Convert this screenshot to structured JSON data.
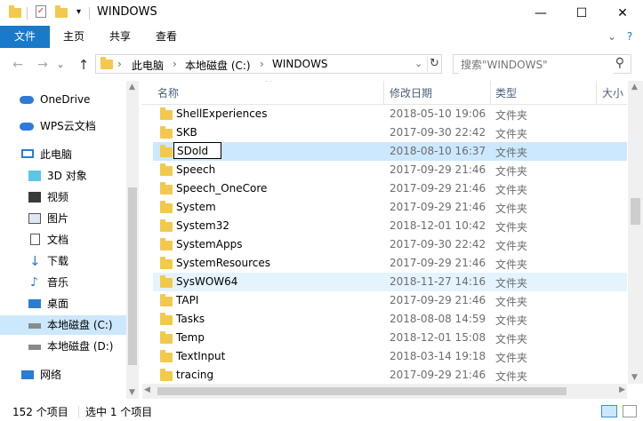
{
  "window": {
    "title": "WINDOWS",
    "minimize": "—",
    "maximize": "☐",
    "close": "✕"
  },
  "ribbon": {
    "tabs": [
      "文件",
      "主页",
      "共享",
      "查看"
    ],
    "expand": "⌄",
    "help": "?"
  },
  "address": {
    "back": "←",
    "forward": "→",
    "recent": "⌄",
    "up": "↑",
    "crumbs": [
      "此电脑",
      "本地磁盘 (C:)",
      "WINDOWS"
    ],
    "separator": "›",
    "dropdown": "⌄",
    "refresh": "↻"
  },
  "search": {
    "placeholder": "搜索\"WINDOWS\"",
    "icon": "⚲"
  },
  "nav": {
    "items": [
      {
        "label": "OneDrive",
        "icon": "cloud-icon"
      },
      {
        "label": "WPS云文档",
        "icon": "cloud-icon"
      },
      {
        "label": "此电脑",
        "icon": "computer-icon"
      },
      {
        "label": "3D 对象",
        "icon": "cube-icon"
      },
      {
        "label": "视频",
        "icon": "video-icon"
      },
      {
        "label": "图片",
        "icon": "picture-icon"
      },
      {
        "label": "文档",
        "icon": "document-icon"
      },
      {
        "label": "下载",
        "icon": "download-icon"
      },
      {
        "label": "音乐",
        "icon": "music-icon"
      },
      {
        "label": "桌面",
        "icon": "desktop-icon"
      },
      {
        "label": "本地磁盘 (C:)",
        "icon": "drive-icon"
      },
      {
        "label": "本地磁盘 (D:)",
        "icon": "drive-icon"
      },
      {
        "label": "网络",
        "icon": "network-icon"
      }
    ]
  },
  "columns": {
    "name": "名称",
    "date": "修改日期",
    "type": "类型",
    "size": "大小"
  },
  "files": [
    {
      "name": "ShellExperiences",
      "date": "2018-05-10 19:06",
      "type": "文件夹"
    },
    {
      "name": "SKB",
      "date": "2017-09-30 22:42",
      "type": "文件夹"
    },
    {
      "name": "SDold",
      "date": "2018-08-10 16:37",
      "type": "文件夹"
    },
    {
      "name": "Speech",
      "date": "2017-09-29 21:46",
      "type": "文件夹"
    },
    {
      "name": "Speech_OneCore",
      "date": "2017-09-29 21:46",
      "type": "文件夹"
    },
    {
      "name": "System",
      "date": "2017-09-29 21:46",
      "type": "文件夹"
    },
    {
      "name": "System32",
      "date": "2018-12-01 10:42",
      "type": "文件夹"
    },
    {
      "name": "SystemApps",
      "date": "2017-09-30 22:42",
      "type": "文件夹"
    },
    {
      "name": "SystemResources",
      "date": "2017-09-29 21:46",
      "type": "文件夹"
    },
    {
      "name": "SysWOW64",
      "date": "2018-11-27 14:16",
      "type": "文件夹"
    },
    {
      "name": "TAPI",
      "date": "2017-09-29 21:46",
      "type": "文件夹"
    },
    {
      "name": "Tasks",
      "date": "2018-08-08 14:59",
      "type": "文件夹"
    },
    {
      "name": "Temp",
      "date": "2018-12-01 15:08",
      "type": "文件夹"
    },
    {
      "name": "TextInput",
      "date": "2018-03-14 19:18",
      "type": "文件夹"
    },
    {
      "name": "tracing",
      "date": "2017-09-29 21:46",
      "type": "文件夹"
    }
  ],
  "status": {
    "count": "152 个项目",
    "selected": "选中 1 个项目"
  },
  "colors": {
    "accent": "#1979ca",
    "selection": "#cce8ff",
    "hover": "#e5f3ff",
    "folder": "#f2c94c"
  }
}
